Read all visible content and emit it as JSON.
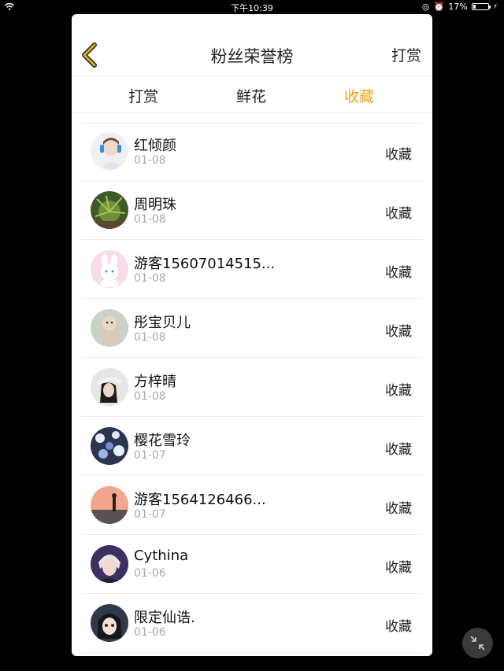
{
  "status": {
    "time": "下午10:39",
    "battery": "17%"
  },
  "header": {
    "title": "粉丝荣誉榜",
    "right_action": "打赏"
  },
  "tabs": [
    {
      "label": "打赏",
      "active": false
    },
    {
      "label": "鲜花",
      "active": false
    },
    {
      "label": "收藏",
      "active": true
    }
  ],
  "colors": {
    "accent": "#f2a31b",
    "back_icon": "#c8a52a"
  },
  "list": [
    {
      "name": "红倾颜",
      "date": "01-08",
      "action": "收藏",
      "avatar": "avatar-boy-headphones"
    },
    {
      "name": "周明珠",
      "date": "01-08",
      "action": "收藏",
      "avatar": "avatar-plant"
    },
    {
      "name": "游客15607014515...",
      "date": "01-08",
      "action": "收藏",
      "avatar": "avatar-bunny"
    },
    {
      "name": "彤宝贝儿",
      "date": "01-08",
      "action": "收藏",
      "avatar": "avatar-cat"
    },
    {
      "name": "方梓晴",
      "date": "01-08",
      "action": "收藏",
      "avatar": "avatar-girl-hat"
    },
    {
      "name": "樱花雪玲",
      "date": "01-07",
      "action": "收藏",
      "avatar": "avatar-flowers"
    },
    {
      "name": "游客1564126466...",
      "date": "01-07",
      "action": "收藏",
      "avatar": "avatar-sunset"
    },
    {
      "name": "Cythina",
      "date": "01-06",
      "action": "收藏",
      "avatar": "avatar-man"
    },
    {
      "name": "限定仙诰.",
      "date": "01-06",
      "action": "收藏",
      "avatar": "avatar-anime"
    }
  ]
}
